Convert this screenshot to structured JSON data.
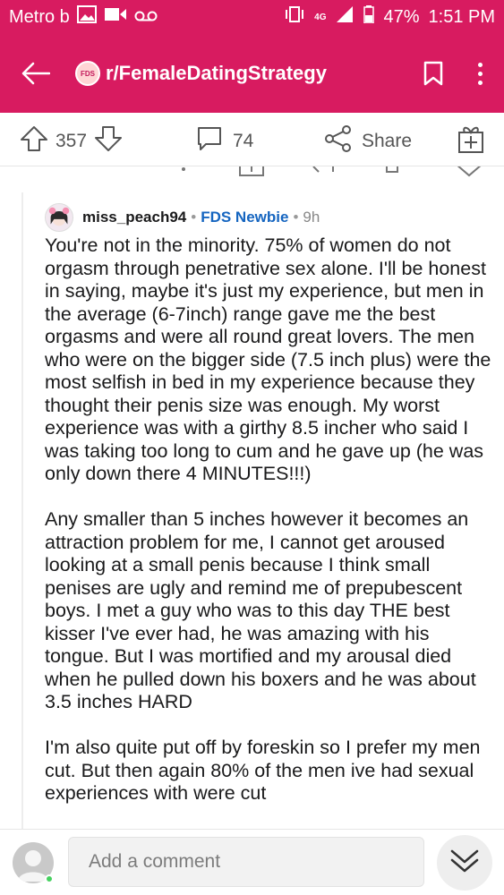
{
  "status_bar": {
    "carrier": "Metro b",
    "battery": "47%",
    "time": "1:51 PM",
    "network": "4G"
  },
  "header": {
    "subreddit_icon_text": "FDS",
    "title": "r/FemaleDatingStrategy"
  },
  "actions": {
    "votes": "357",
    "comments": "74",
    "share_label": "Share"
  },
  "comment": {
    "username": "miss_peach94",
    "flair": "FDS Newbie",
    "time": "9h",
    "paragraphs": [
      "You're not in the minority. 75% of women do not orgasm through penetrative sex alone. I'll be honest in saying, maybe it's just my experience, but men in the average (6-7inch) range gave me the best orgasms and were all round great lovers. The men who were on the bigger side (7.5 inch plus) were the most selfish in bed in my experience because they thought their penis size was enough. My worst experience was with a girthy 8.5 incher who said I was taking too long to cum and he gave up (he was only down there 4 MINUTES!!!)",
      "Any smaller than 5 inches however it becomes an attraction problem for me, I cannot get aroused looking at a small penis because I think small penises are ugly and remind me of prepubescent boys. I met a guy who was to this day THE best kisser I've ever had, he was amazing with his tongue. But I was mortified and my arousal died when he pulled down his boxers and he was about 3.5 inches HARD",
      "I'm also quite put off by foreskin so I prefer my men cut. But then again 80% of the men ive had sexual experiences with were cut"
    ]
  },
  "composer": {
    "placeholder": "Add a comment"
  },
  "colors": {
    "brand": "#d81b60",
    "flair": "#1565c0",
    "online": "#46d160"
  }
}
